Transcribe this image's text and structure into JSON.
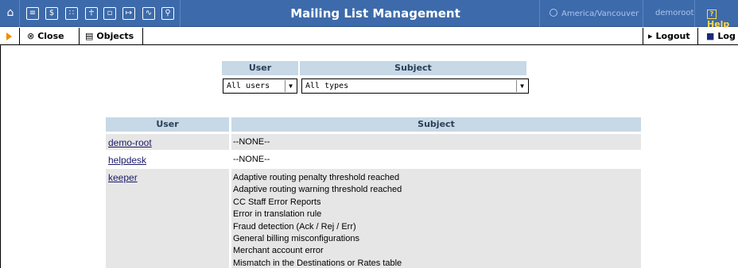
{
  "header": {
    "title": "Mailing List Management",
    "timezone": "America/Vancouver",
    "username": "demoroot",
    "help_label": "Help"
  },
  "nav_icons": [
    "home-icon",
    "list-icon",
    "dollar-icon",
    "nodes-icon",
    "person-icon",
    "window-icon",
    "export-icon",
    "chart-icon",
    "search-icon"
  ],
  "toolbar": {
    "close_label": "Close",
    "objects_label": "Objects",
    "logout_label": "Logout",
    "log_label": "Log"
  },
  "filter": {
    "user_header": "User",
    "subject_header": "Subject",
    "user_selected": "All users",
    "subject_selected": "All types"
  },
  "table": {
    "columns": [
      "User",
      "Subject"
    ],
    "rows": [
      {
        "user": "demo-root",
        "subjects": [
          "--NONE--"
        ]
      },
      {
        "user": "helpdesk",
        "subjects": [
          "--NONE--"
        ]
      },
      {
        "user": "keeper",
        "subjects": [
          "Adaptive routing penalty threshold reached",
          "Adaptive routing warning threshold reached",
          "CC Staff Error Reports",
          "Error in translation rule",
          "Fraud detection (Ack / Rej / Err)",
          "General billing misconfigurations",
          "Merchant account error",
          "Mismatch in the Destinations or Rates table"
        ]
      }
    ]
  },
  "colors": {
    "header_bg": "#3D6AAA",
    "table_header_bg": "#c7d8e6",
    "row_bg": "#e6e6e6",
    "help_color": "#ffd84a",
    "arrow_color": "#f08c00"
  }
}
